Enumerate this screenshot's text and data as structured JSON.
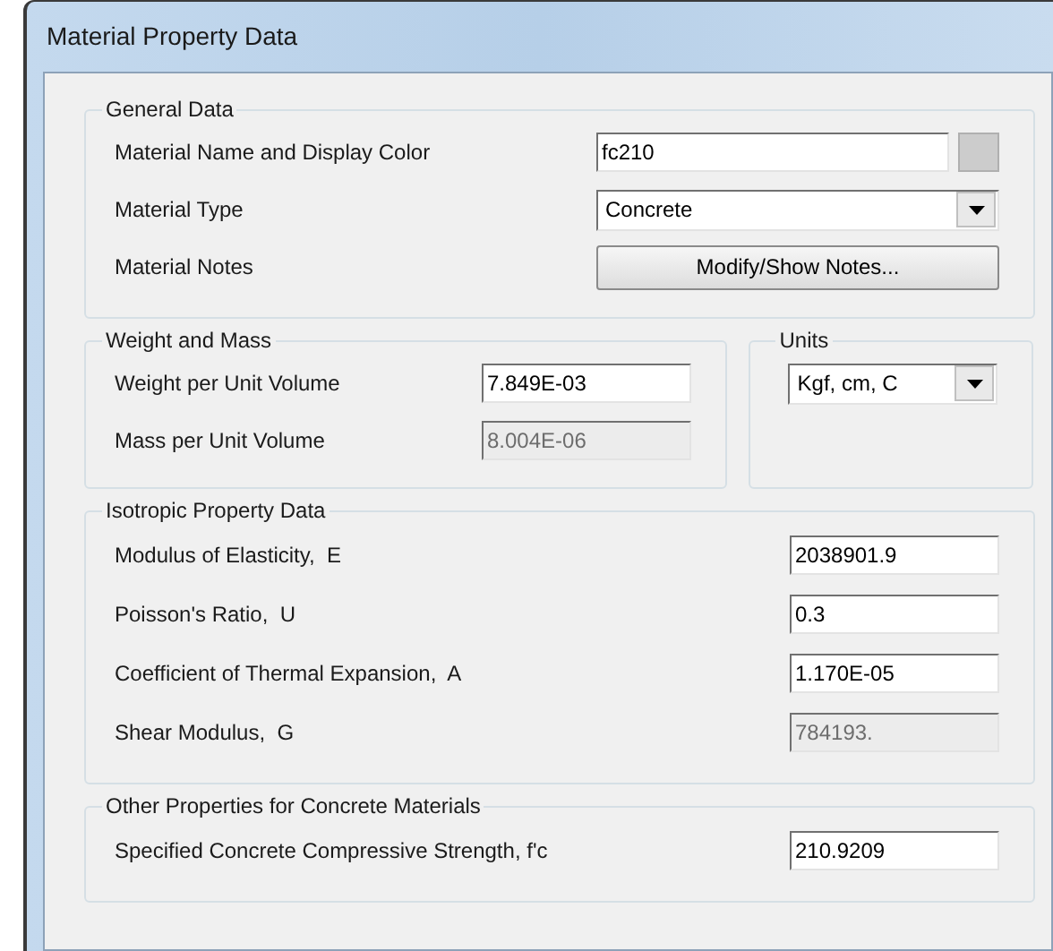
{
  "window": {
    "title": "Material Property Data"
  },
  "general_data": {
    "title": "General Data",
    "rows": [
      {
        "kind": "text",
        "label": "Material Name and Display Color",
        "value": "fc210",
        "disabled": false,
        "color": "#cccccc"
      },
      {
        "kind": "dropdown",
        "label": "Material Type",
        "value": "Concrete"
      },
      {
        "kind": "button",
        "label": "Material Notes",
        "button": "Modify/Show Notes..."
      }
    ]
  },
  "weight_and_mass": {
    "title": "Weight and Mass",
    "rows": [
      {
        "kind": "text",
        "label": "Weight per Unit Volume",
        "value": "7.849E-03",
        "disabled": false
      },
      {
        "kind": "text",
        "label": "Mass per Unit Volume",
        "value": "8.004E-06",
        "disabled": true
      }
    ]
  },
  "units": {
    "title": "Units",
    "rows": [
      {
        "kind": "dropdown",
        "value": "Kgf, cm, C"
      }
    ]
  },
  "isotropic_property_data": {
    "title": "Isotropic Property Data",
    "rows": [
      {
        "kind": "text",
        "label": "Modulus of Elasticity,  E",
        "value": "2038901.9",
        "disabled": false
      },
      {
        "kind": "text",
        "label": "Poisson's Ratio,  U",
        "value": "0.3",
        "disabled": false
      },
      {
        "kind": "text",
        "label": "Coefficient of Thermal Expansion,  A",
        "value": "1.170E-05",
        "disabled": false
      },
      {
        "kind": "text",
        "label": "Shear Modulus,  G",
        "value": "784193.",
        "disabled": true
      }
    ]
  },
  "concrete_properties": {
    "title": "Other Properties for Concrete Materials",
    "rows": [
      {
        "kind": "text",
        "label": "Specified Concrete Compressive Strength, f'c",
        "value": "210.9209",
        "disabled": false
      }
    ]
  }
}
